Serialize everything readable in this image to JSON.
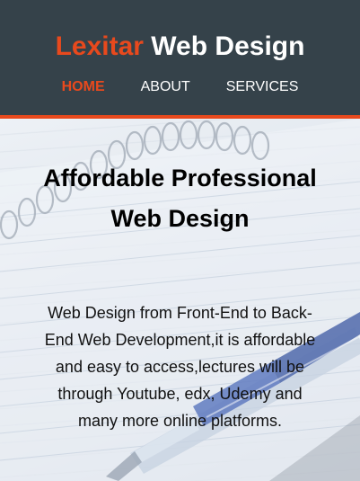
{
  "header": {
    "brand_highlight": "Lexitar",
    "brand_rest": " Web Design",
    "nav": [
      {
        "label": "HOME",
        "active": true
      },
      {
        "label": "ABOUT",
        "active": false
      },
      {
        "label": "SERVICES",
        "active": false
      }
    ]
  },
  "showcase": {
    "title": "Affordable Professional Web Design",
    "text": "Web Design from Front-End to Back-End Web Development,it is affordable and easy to access,lectures will be through Youtube, edx, Udemy and many more online platforms."
  },
  "colors": {
    "header_bg": "#35424a",
    "accent": "#e8491d",
    "nav_text": "#ffffff"
  }
}
